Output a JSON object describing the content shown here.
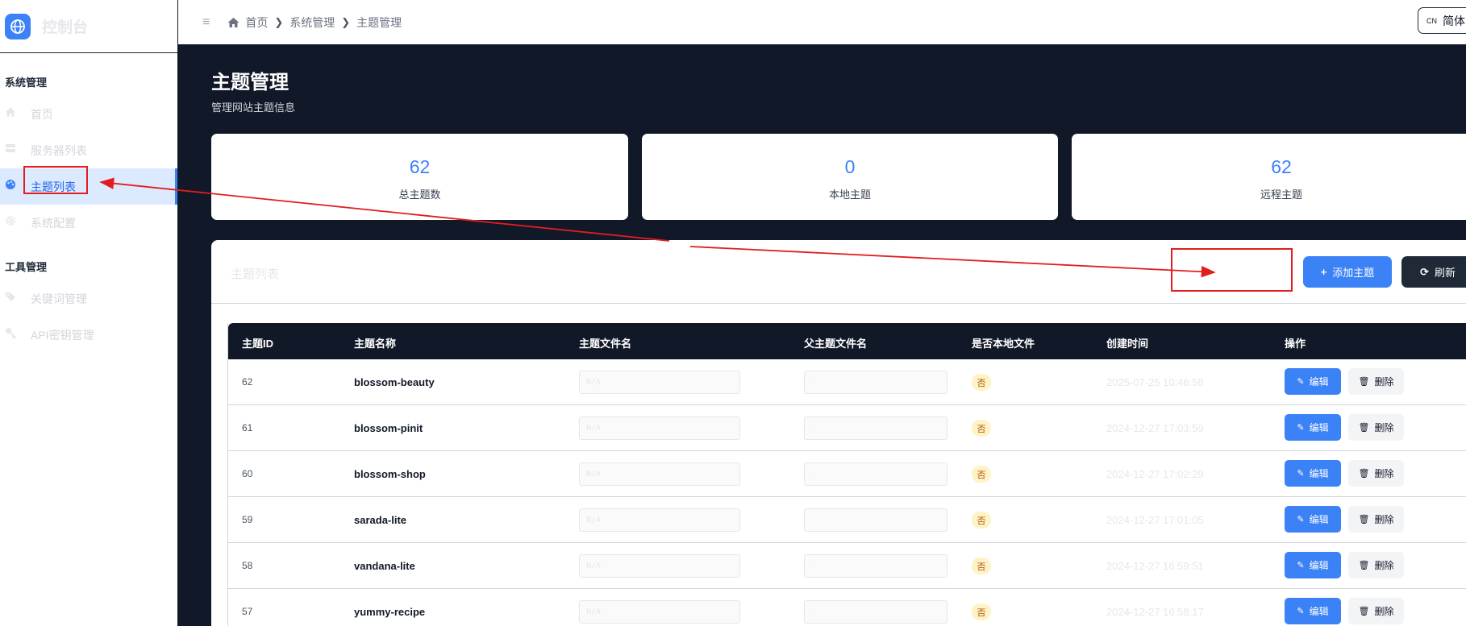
{
  "brand": {
    "title": "控制台",
    "logo_icon": "globe-icon"
  },
  "sidebar": {
    "sections": [
      {
        "title": "系统管理",
        "items": [
          {
            "label": "首页",
            "icon": "home-icon",
            "active": false
          },
          {
            "label": "服务器列表",
            "icon": "server-icon",
            "active": false
          },
          {
            "label": "主题列表",
            "icon": "palette-icon",
            "active": true
          },
          {
            "label": "系统配置",
            "icon": "gear-icon",
            "active": false
          }
        ]
      },
      {
        "title": "工具管理",
        "items": [
          {
            "label": "关键词管理",
            "icon": "tag-icon",
            "active": false
          },
          {
            "label": "API密钥管理",
            "icon": "key-icon",
            "active": false
          }
        ]
      }
    ]
  },
  "topbar": {
    "menu_icon": "≡",
    "breadcrumb": [
      "首页",
      "系统管理",
      "主题管理"
    ],
    "language": {
      "code": "CN",
      "label": "简体"
    }
  },
  "header": {
    "title": "主题管理",
    "subtitle": "管理网站主题信息"
  },
  "stats": [
    {
      "value": "62",
      "label": "总主题数"
    },
    {
      "value": "0",
      "label": "本地主题"
    },
    {
      "value": "62",
      "label": "远程主题"
    }
  ],
  "panel": {
    "title": "主题列表",
    "add_button": "添加主题",
    "refresh_button": "刷新"
  },
  "table": {
    "columns": [
      "主题ID",
      "主题名称",
      "主题文件名",
      "父主题文件名",
      "是否本地文件",
      "创建时间",
      "操作"
    ],
    "file_placeholder": "N/A",
    "parent_placeholder": "-",
    "edit_label": "编辑",
    "delete_label": "删除",
    "rows": [
      {
        "id": "62",
        "name": "blossom-beauty",
        "local": "否",
        "created": "2025-07-25 10:46:58"
      },
      {
        "id": "61",
        "name": "blossom-pinit",
        "local": "否",
        "created": "2024-12-27 17:03:59"
      },
      {
        "id": "60",
        "name": "blossom-shop",
        "local": "否",
        "created": "2024-12-27 17:02:29"
      },
      {
        "id": "59",
        "name": "sarada-lite",
        "local": "否",
        "created": "2024-12-27 17:01:05"
      },
      {
        "id": "58",
        "name": "vandana-lite",
        "local": "否",
        "created": "2024-12-27 16:59:51"
      },
      {
        "id": "57",
        "name": "yummy-recipe",
        "local": "否",
        "created": "2024-12-27 16:58:17"
      }
    ]
  },
  "colors": {
    "accent": "#3b82f6",
    "dark": "#111827",
    "annotation": "#e11d1d",
    "badge_bg": "#fef3c7"
  }
}
